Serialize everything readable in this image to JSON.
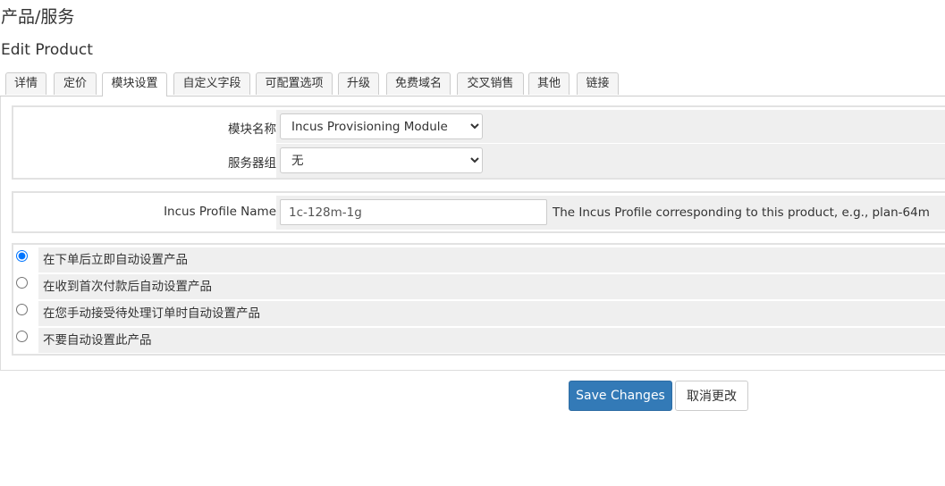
{
  "header": {
    "title": "产品/服务",
    "subtitle": "Edit Product"
  },
  "tabs": [
    {
      "label": "详情",
      "active": false
    },
    {
      "label": "定价",
      "active": false
    },
    {
      "label": "模块设置",
      "active": true
    },
    {
      "label": "自定义字段",
      "active": false
    },
    {
      "label": "可配置选项",
      "active": false
    },
    {
      "label": "升级",
      "active": false
    },
    {
      "label": "免费域名",
      "active": false
    },
    {
      "label": "交叉销售",
      "active": false
    },
    {
      "label": "其他",
      "active": false
    },
    {
      "label": "链接",
      "active": false
    }
  ],
  "module": {
    "module_name_label": "模块名称",
    "module_name_value": "Incus Provisioning Module",
    "server_group_label": "服务器组",
    "server_group_value": "无"
  },
  "profile": {
    "label": "Incus Profile Name",
    "value": "1c-128m-1g",
    "hint": "The Incus Profile corresponding to this product, e.g., plan-64m"
  },
  "setup_options": [
    {
      "label": "在下单后立即自动设置产品",
      "checked": true
    },
    {
      "label": "在收到首次付款后自动设置产品",
      "checked": false
    },
    {
      "label": "在您手动接受待处理订单时自动设置产品",
      "checked": false
    },
    {
      "label": "不要自动设置此产品",
      "checked": false
    }
  ],
  "actions": {
    "save_label": "Save Changes",
    "cancel_label": "取消更改"
  }
}
